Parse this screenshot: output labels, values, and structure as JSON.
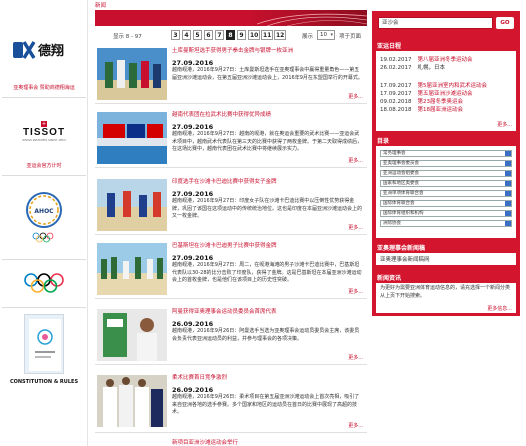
{
  "breadcrumb": "新闻",
  "pager": {
    "info": "显示 8 - 97",
    "pages": [
      "3",
      "4",
      "5",
      "6",
      "7",
      "8",
      "9",
      "10",
      "11",
      "12"
    ],
    "active_index": 5,
    "per_label": "展示",
    "per_value": "10",
    "per_suffix": "项于页面"
  },
  "sponsors": [
    {
      "name": "德翔",
      "caption": "亚奥理事会 赞助商德翔海运"
    },
    {
      "name": "TISSOT",
      "sub": "SWISS WATCHES SINCE 1853",
      "caption": "亚运会官方计时"
    },
    {
      "name": "AHOC"
    },
    {
      "name": "Olympic rings"
    },
    {
      "name": "CONSTITUTION & RULES"
    }
  ],
  "articles": [
    {
      "title": "土库曼斯坦选手获得男子拳击金牌与银牌一枚亚洲",
      "date": "27.09.2016",
      "body": "越南岘港，2016年9月27日：土库曼斯坦选手在亚奥理事会中赢得重量角色——第五届亚洲沙滩运动会，在第五届亚洲沙滩运动会上，2016年9月在东盟国举行的开幕式。",
      "more": "更多..."
    },
    {
      "title": "越南代表团在拉武术比赛中获得优异成绩",
      "date": "27.09.2016",
      "body": "越南岘港，2016年9月27日：越南的岘港，就在奥运会重要的武术比赛——亚运会武术项目中，越南武术代表队在第三天的比赛中获得了两枚金牌。于第二天取得成绩后，在这场比赛中，越南代表团在武术比赛中将继续展示实力。",
      "more": "更多..."
    },
    {
      "title": "印度选手在沙滩卡巴迪比赛中获得女子金牌",
      "date": "27.09.2016",
      "body": "越南岘港，2016年9月27日：印度女子队在沙滩卡巴迪比赛中以压倒性优势获得金牌，巩固了该国在这项运动中的传统统治地位。这也是印度在本届亚洲沙滩运动会上的又一枚金牌。",
      "more": "更多..."
    },
    {
      "title": "巴基斯坦在沙滩卡巴迪男子比赛中获得金牌",
      "date": "27.09.2016",
      "body": "越南岘港，2016年9月27日：周二，在岘港海滩的男子沙滩卡巴迪比赛中，巴基斯坦代表队以30-28的比分击败了印度队，获得了金牌。这是巴基斯坦在本届亚洲沙滩运动会上的首枚金牌，也是他们在该项目上的历史性突破。",
      "more": "更多..."
    },
    {
      "title": "阿曼获得亚奥理事会运动员委员会首席代表",
      "date": "26.09.2016",
      "body": "越南岘港，2016年9月26日：阿曼选手当选为亚奥理事会运动员委员会主席，该委员会负责代表亚洲运动员的利益，并参与理事会的各项决策。",
      "more": "更多..."
    },
    {
      "title": "柔术比赛首日竞争激烈",
      "date": "26.09.2016",
      "body": "越南岘港，2016年9月26日：柔术项目在第五届亚洲沙滩运动会上首次亮相，吸引了来自亚洲各地的选手参赛。多个国家和地区的运动员在首日的比赛中展现了高超的技术。",
      "more": "更多..."
    },
    {
      "title": "新项目亚洲沙滩运动会举行"
    }
  ],
  "right": {
    "search_value": "亚沙会",
    "go_label": "GO",
    "calendar_title": "亚运日程",
    "calendar": [
      {
        "date": "19.02.2017",
        "event": "第八届亚洲冬季运动会"
      },
      {
        "date": "26.02.2017",
        "event": "札幌，日本"
      },
      {
        "date": "17.09.2017",
        "event": "第5届亚洲室内和武术运动会"
      },
      {
        "date": "17.09.2017",
        "event": "第五届亚洲沙滩运动会"
      },
      {
        "date": "09.02.2018",
        "event": "第23届冬季奥运会"
      },
      {
        "date": "18.08.2018",
        "event": "第18届亚洲运动会"
      }
    ],
    "calendar_more": "更多...",
    "directory_title": "目录",
    "directory": [
      "常务理事会",
      "亚奥理事会委员会",
      "亚洲运动会组委会",
      "国家和地区奥委会",
      "亚洲单项体育联合会",
      "国际体育联合会",
      "国际体育组织和机构",
      "洲际协会"
    ],
    "sport_title": "亚奥理事会新闻稿",
    "sport_link": "亚奥理事会新闻稿网",
    "letter_title": "新闻资讯",
    "letter_body": "为更好为需要亚洲体育运动信息的，请充选择一个新闻分类从上页下开始搜索。",
    "letter_more": "更多信息..."
  },
  "colors": {
    "brand_red": "#c8102e",
    "panel_red": "#d3152d"
  }
}
